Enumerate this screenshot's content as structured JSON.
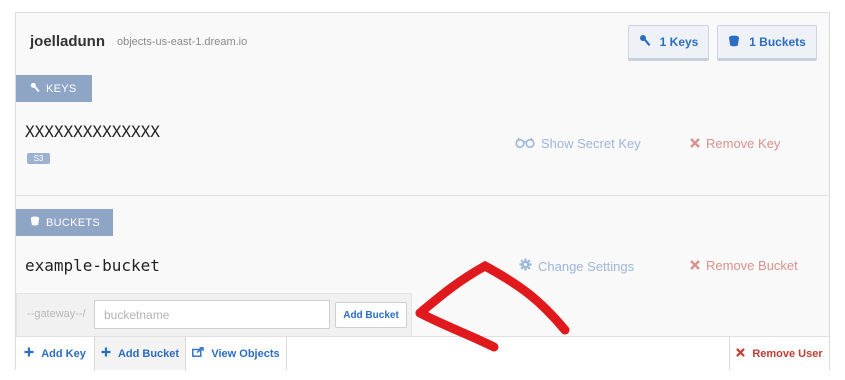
{
  "user": {
    "name": "joelladunn",
    "host": "objects-us-east-1.dream.io"
  },
  "header_buttons": {
    "keys": "1 Keys",
    "buckets": "1 Buckets"
  },
  "keys_section": {
    "label": "KEYS",
    "key_id": "XXXXXXXXXXXXXX",
    "badge": "S3",
    "show_secret": "Show Secret Key",
    "remove": "Remove Key"
  },
  "buckets_section": {
    "label": "BUCKETS",
    "bucket_name": "example-bucket",
    "change_settings": "Change Settings",
    "remove": "Remove Bucket"
  },
  "add_bucket_form": {
    "gateway": "--gateway--/",
    "placeholder": "bucketname",
    "button": "Add Bucket"
  },
  "footer": {
    "add_key": "Add Key",
    "add_bucket": "Add Bucket",
    "view_objects": "View Objects",
    "remove_user": "Remove User"
  },
  "colors": {
    "accent": "#2a6dc2",
    "danger": "#c33b32",
    "section_label": "#8fa5c6",
    "annotation_arrow": "#e0191c"
  },
  "icons": [
    "key-icon",
    "bucket-icon",
    "glasses-icon",
    "close-icon",
    "gear-icon",
    "plus-icon",
    "share-icon"
  ]
}
